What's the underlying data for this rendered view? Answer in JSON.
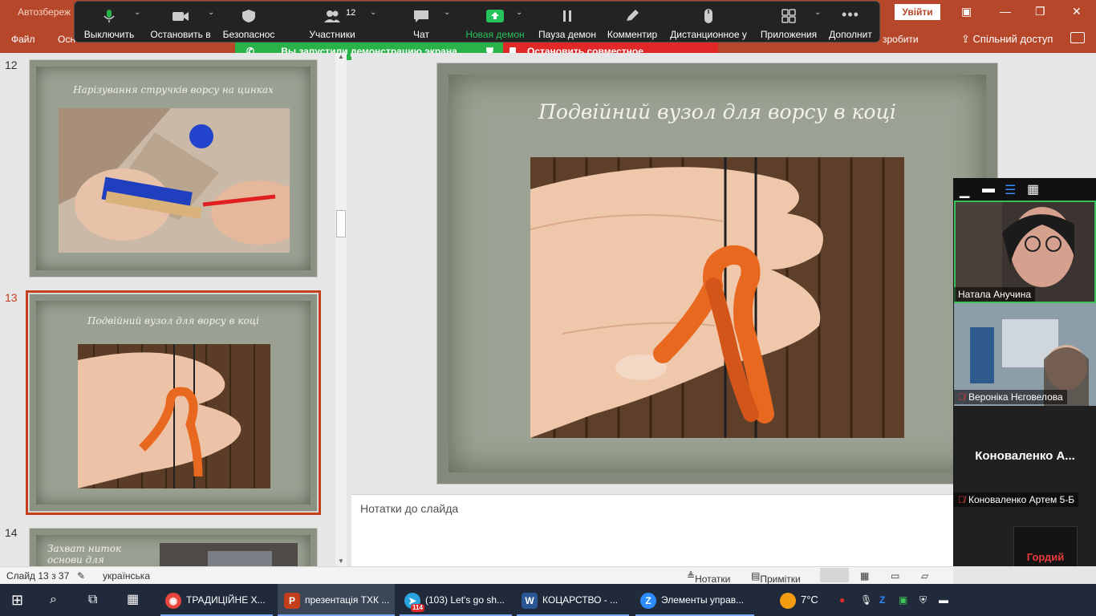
{
  "ppt": {
    "title_left": "Автозбереж",
    "menu_file": "Файл",
    "menu_osn": "Осн",
    "tell_me": "зробити",
    "share": "Спільний доступ",
    "signin": "Увійти"
  },
  "zoom_toolbar": {
    "mute": "Выключить",
    "stop_video": "Остановить в",
    "security": "Безопаснос",
    "participants": "Участники",
    "participants_count": "12",
    "chat": "Чат",
    "new_share": "Новая демон",
    "pause_share": "Пауза демон",
    "annotate": "Комментир",
    "remote_control": "Дистанционное у",
    "apps": "Приложения",
    "more": "Дополнит"
  },
  "banners": {
    "sharing": "Вы запустили демонстрацию экрана",
    "stop": "Остановить совместное использование"
  },
  "slides": {
    "thumbs": [
      {
        "num": "12",
        "title": "Нарізування стручків ворсу на цинках"
      },
      {
        "num": "13",
        "title": "Подвійний вузол для ворсу в коці"
      },
      {
        "num": "14",
        "title": "Захват ниток основи для"
      }
    ],
    "current_title": "Подвійний вузол для ворсу в коці",
    "notes_placeholder": "Нотатки до слайда"
  },
  "participants": [
    {
      "name": "Натала Анучина",
      "muted": false,
      "active": true
    },
    {
      "name": "Вероніка Нєговелова",
      "muted": true
    },
    {
      "name": "Коноваленко Артем 5-Б",
      "muted": true,
      "display": "Коноваленко А..."
    },
    {
      "name": "Владимиров Гордий",
      "muted": true,
      "avatar_text": "Гордий"
    }
  ],
  "status_bar": {
    "slide_info": "Слайд 13 з 37",
    "language": "українська",
    "notes": "Нотатки",
    "comments": "Примітки"
  },
  "taskbar": {
    "items": [
      {
        "label": "ТРАДИЦІЙНЕ Х..."
      },
      {
        "label": "презентація ТХК ..."
      },
      {
        "label": "(103) Let's go sh...",
        "badge": "114"
      },
      {
        "label": "КОЦАРСТВО - ..."
      },
      {
        "label": "Элементы управ..."
      }
    ],
    "weather": "7°C"
  },
  "colors": {
    "ppt_accent": "#b7472a",
    "zoom_green": "#2ab24a",
    "zoom_red": "#e02828"
  }
}
